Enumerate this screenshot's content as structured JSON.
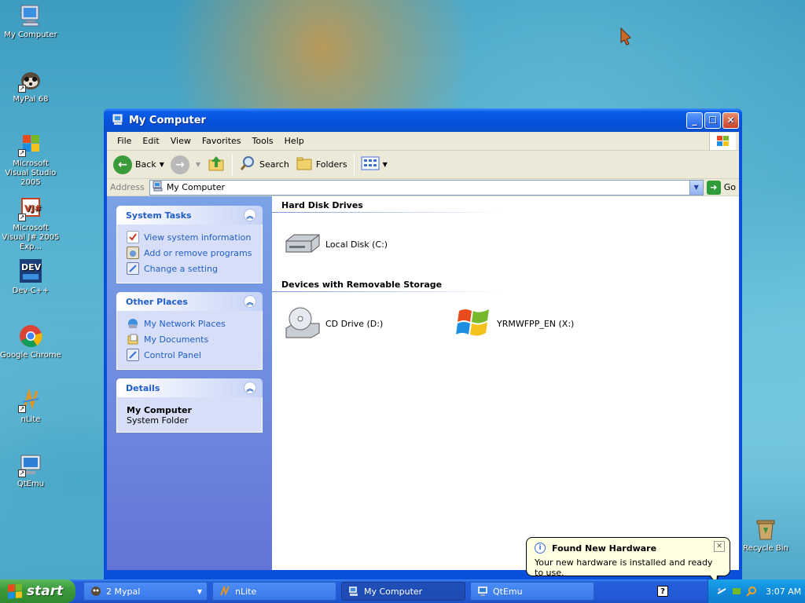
{
  "desktop": {
    "icons": [
      {
        "label": "My Computer",
        "icon": "my-computer-icon"
      },
      {
        "label": "MyPal 68",
        "icon": "mypal-icon"
      },
      {
        "label": "Microsoft Visual Studio 2005",
        "icon": "visual-studio-icon"
      },
      {
        "label": "Microsoft Visual J# 2005 Exp...",
        "icon": "visual-j-sharp-icon"
      },
      {
        "label": "Dev-C++",
        "icon": "dev-cpp-icon"
      },
      {
        "label": "Google Chrome",
        "icon": "chrome-icon"
      },
      {
        "label": "nLite",
        "icon": "nlite-icon"
      },
      {
        "label": "QtEmu",
        "icon": "qtemu-icon"
      },
      {
        "label": "Recycle Bin",
        "icon": "recycle-bin-icon"
      }
    ]
  },
  "window": {
    "title": "My Computer",
    "menu": [
      "File",
      "Edit",
      "View",
      "Favorites",
      "Tools",
      "Help"
    ],
    "toolbar": {
      "back_label": "Back",
      "search_label": "Search",
      "folders_label": "Folders"
    },
    "address": {
      "label": "Address",
      "value": "My Computer",
      "go_label": "Go"
    },
    "sidepane": {
      "system_tasks": {
        "title": "System Tasks",
        "items": [
          "View system information",
          "Add or remove programs",
          "Change a setting"
        ]
      },
      "other_places": {
        "title": "Other Places",
        "items": [
          "My Network Places",
          "My Documents",
          "Control Panel"
        ]
      },
      "details": {
        "title": "Details",
        "name": "My Computer",
        "type": "System Folder"
      }
    },
    "groups": {
      "hard_disk": {
        "title": "Hard Disk Drives",
        "items": [
          "Local Disk (C:)"
        ]
      },
      "removable": {
        "title": "Devices with Removable Storage",
        "items": [
          "CD Drive (D:)",
          "YRMWFPP_EN (X:)"
        ]
      }
    }
  },
  "balloon": {
    "title": "Found New Hardware",
    "text": "Your new hardware is installed and ready to use."
  },
  "taskbar": {
    "start_label": "start",
    "tasks": [
      "2 Mypal",
      "nLite",
      "My Computer",
      "QtEmu"
    ],
    "clock": "3:07 AM"
  },
  "colors": {
    "title_blue": "#0a4fd9",
    "task_link": "#215dc6",
    "start_green": "#3c9a3c",
    "tray_blue": "#0f8bdb"
  }
}
